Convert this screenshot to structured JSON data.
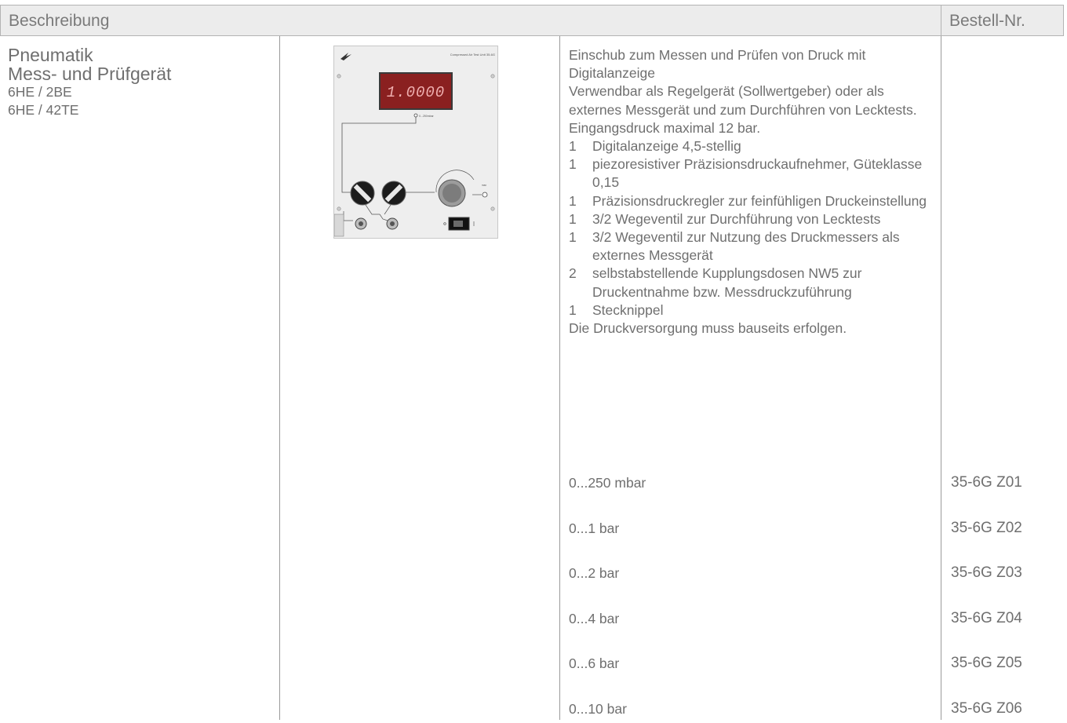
{
  "header": {
    "description_label": "Beschreibung",
    "order_label": "Bestell-Nr."
  },
  "product": {
    "title_line1": "Pneumatik",
    "title_line2": "Mess- und Prüfgerät",
    "spec1": "6HE / 2BE",
    "spec2": "6HE / 42TE"
  },
  "device": {
    "display_value": "1.0000",
    "panel_label": "Compressed Air Test Unit 35-6G",
    "range_label": "0...250mbar"
  },
  "description": {
    "intro": "Einschub zum Messen und Prüfen von Druck mit Digitalanzeige",
    "usage": "Verwendbar als Regelgerät (Sollwertgeber) oder als externes Messgerät und zum Durchführen von Lecktests. Eingangsdruck maximal 12 bar.",
    "items": [
      {
        "qty": "1",
        "text": "Digitalanzeige 4,5-stellig"
      },
      {
        "qty": "1",
        "text": "piezoresistiver Präzisionsdruckaufnehmer, Güteklasse 0,15"
      },
      {
        "qty": "1",
        "text": "Präzisionsdruckregler zur feinfühligen Druckeinstellung"
      },
      {
        "qty": "1",
        "text": "3/2 Wegeventil zur Durchführung von Lecktests"
      },
      {
        "qty": "1",
        "text": "3/2 Wegeventil zur Nutzung des Druckmessers als externes Messgerät"
      },
      {
        "qty": "2",
        "text": "selbstabstellende Kupplungsdosen NW5 zur Druckentnahme bzw. Messdruckzuführung"
      },
      {
        "qty": "1",
        "text": "Stecknippel"
      }
    ],
    "note": "Die Druckversorgung muss bauseits erfolgen."
  },
  "orders": [
    {
      "range": "0...250 mbar",
      "code": "35-6G Z01"
    },
    {
      "range": "0...1 bar",
      "code": "35-6G Z02"
    },
    {
      "range": "0...2 bar",
      "code": "35-6G Z03"
    },
    {
      "range": "0...4 bar",
      "code": "35-6G Z04"
    },
    {
      "range": "0...6 bar",
      "code": "35-6G Z05"
    },
    {
      "range": "0...10 bar",
      "code": "35-6G Z06"
    }
  ]
}
